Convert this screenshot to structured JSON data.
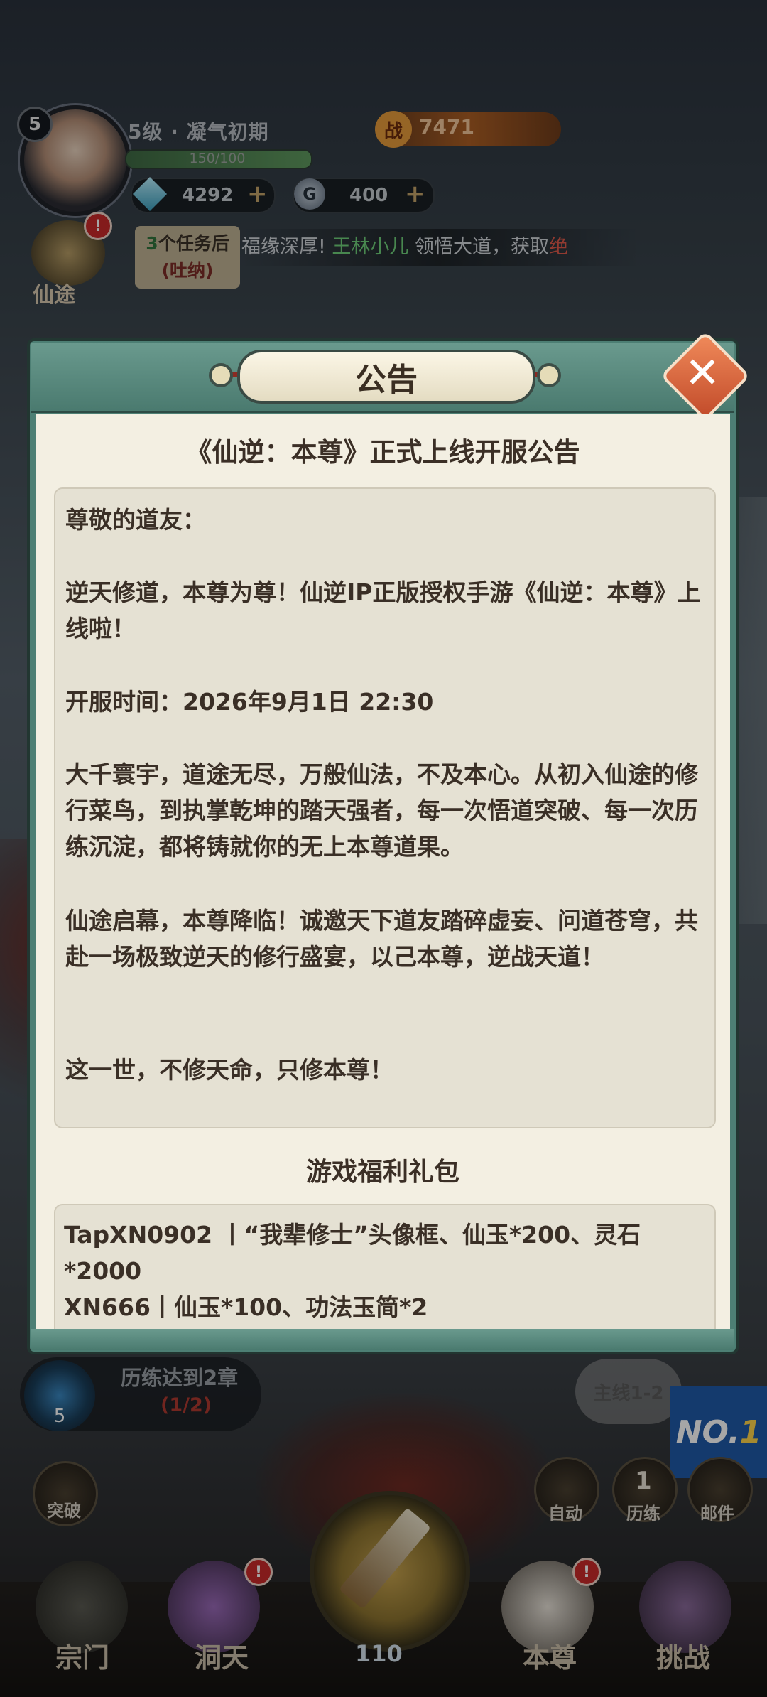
{
  "player": {
    "level_badge": "5",
    "level_text": "5级 · 凝气初期",
    "xp_text": "150/100",
    "xp_fraction": 1.0,
    "power_icon": "战",
    "power_value": "7471",
    "gems": "4292",
    "coin_icon": "G",
    "coins": "400",
    "plus": "+"
  },
  "xiantu": {
    "label": "仙途",
    "alert": "!",
    "task_prefix": "3",
    "task_text": "个任务后",
    "task_sub": "(吐纳)"
  },
  "ticker": {
    "prefix": "福缘深厚! ",
    "name": "王林小儿",
    "middle": " 领悟大道，获取",
    "suffix": "绝"
  },
  "modal": {
    "title": "公告",
    "close_icon": "✕",
    "announcement_title": "《仙逆：本尊》正式上线开服公告",
    "paragraphs": {
      "p1": "尊敬的道友：",
      "p2": "逆天修道，本尊为尊！仙逆IP正版授权手游《仙逆：本尊》上线啦！",
      "p3": "开服时间：2026年9月1日 22:30",
      "p4": "大千寰宇，道途无尽，万般仙法，不及本心。从初入仙途的修行菜鸟，到执掌乾坤的踏天强者，每一次悟道突破、每一次历练沉淀，都将铸就你的无上本尊道果。",
      "p5": "仙途启幕，本尊降临！诚邀天下道友踏碎虚妄、问道苍穹，共赴一场极致逆天的修行盛宴，以己本尊，逆战天道！",
      "p6": "这一世，不修天命，只修本尊！"
    },
    "gift_title": "游戏福利礼包",
    "gifts": {
      "g1": "TapXN0902 丨“我辈修士”头像框、仙玉*200、灵石*2000",
      "g2": "XN666丨仙玉*100、功法玉简*2"
    }
  },
  "bottom": {
    "quest_text": "历练达到2章",
    "quest_progress": "(1/2)",
    "quest_level": "5",
    "mainline": "主线1-2",
    "no1_prefix": "NO.",
    "no1_num": "1",
    "breakthrough": "突破",
    "auto": "自动",
    "training": "历练",
    "training_count": "1",
    "mail": "邮件",
    "energy": "110"
  },
  "nav": {
    "sect": "宗门",
    "cave": "洞天",
    "self": "本尊",
    "challenge": "挑战",
    "alert": "!"
  }
}
